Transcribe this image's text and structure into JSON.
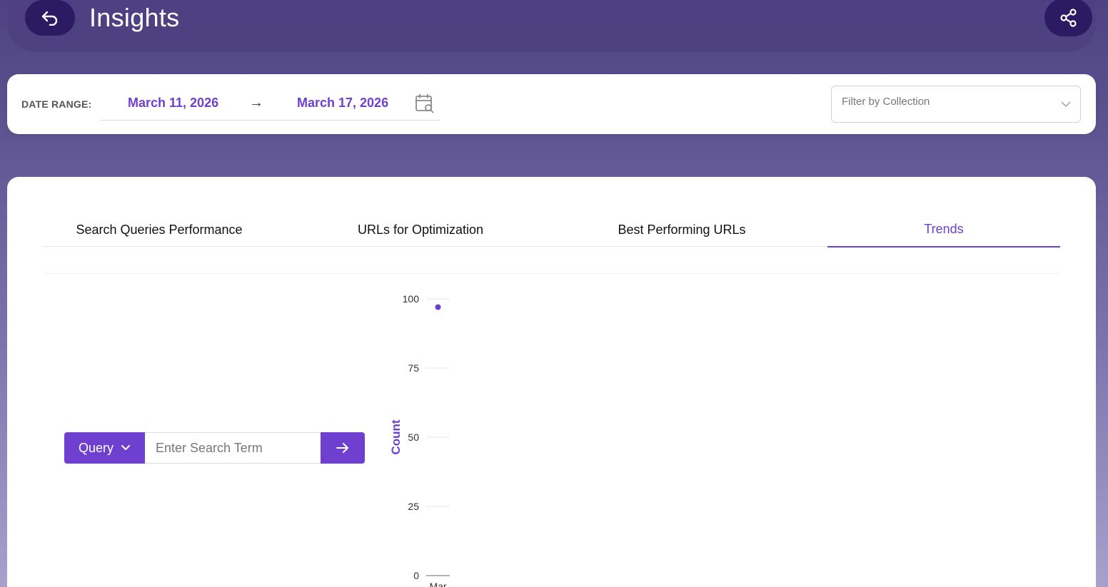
{
  "header": {
    "title": "Insights",
    "back_icon": "back-arrow-icon",
    "share_icon": "share-icon"
  },
  "date_range": {
    "label": "DATE RANGE:",
    "start": "March 11, 2026",
    "arrow": "→",
    "end": "March 17, 2026",
    "calendar_icon": "calendar-search-icon"
  },
  "filter": {
    "placeholder": "Filter by Collection"
  },
  "tabs": [
    {
      "label": "Search Queries Performance",
      "active": false
    },
    {
      "label": "URLs for Optimization",
      "active": false
    },
    {
      "label": "Best Performing URLs",
      "active": false
    },
    {
      "label": "Trends",
      "active": true
    }
  ],
  "search": {
    "mode_label": "Query",
    "placeholder": "Enter Search Term"
  },
  "colors": {
    "accent": "#6f3fcf",
    "header_button": "#2c1a63"
  },
  "chart_data": {
    "type": "scatter",
    "ylabel": "Count",
    "ylim": [
      0,
      100
    ],
    "yticks": [
      0,
      25,
      50,
      75,
      100
    ],
    "x_tick_labels": [
      "Mar"
    ],
    "points": [
      {
        "x": "Mar",
        "y": 97
      }
    ],
    "grid": true
  }
}
